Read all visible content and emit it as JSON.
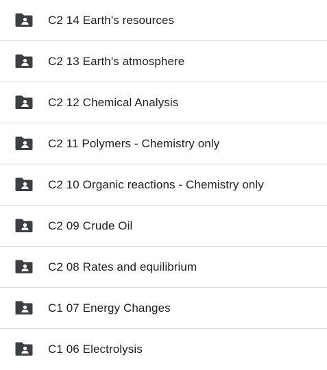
{
  "folders": {
    "icon": "shared-folder-icon",
    "icon_color": "#3c4043",
    "divider_color": "#dadce0",
    "items": [
      {
        "name": "C2 14 Earth's resources"
      },
      {
        "name": "C2 13 Earth's atmosphere"
      },
      {
        "name": "C2 12 Chemical Analysis"
      },
      {
        "name": "C2 11 Polymers - Chemistry only"
      },
      {
        "name": "C2 10 Organic reactions - Chemistry only"
      },
      {
        "name": "C2 09 Crude Oil"
      },
      {
        "name": "C2 08 Rates and equilibrium"
      },
      {
        "name": "C1 07 Energy Changes"
      },
      {
        "name": "C1 06 Electrolysis"
      }
    ]
  }
}
